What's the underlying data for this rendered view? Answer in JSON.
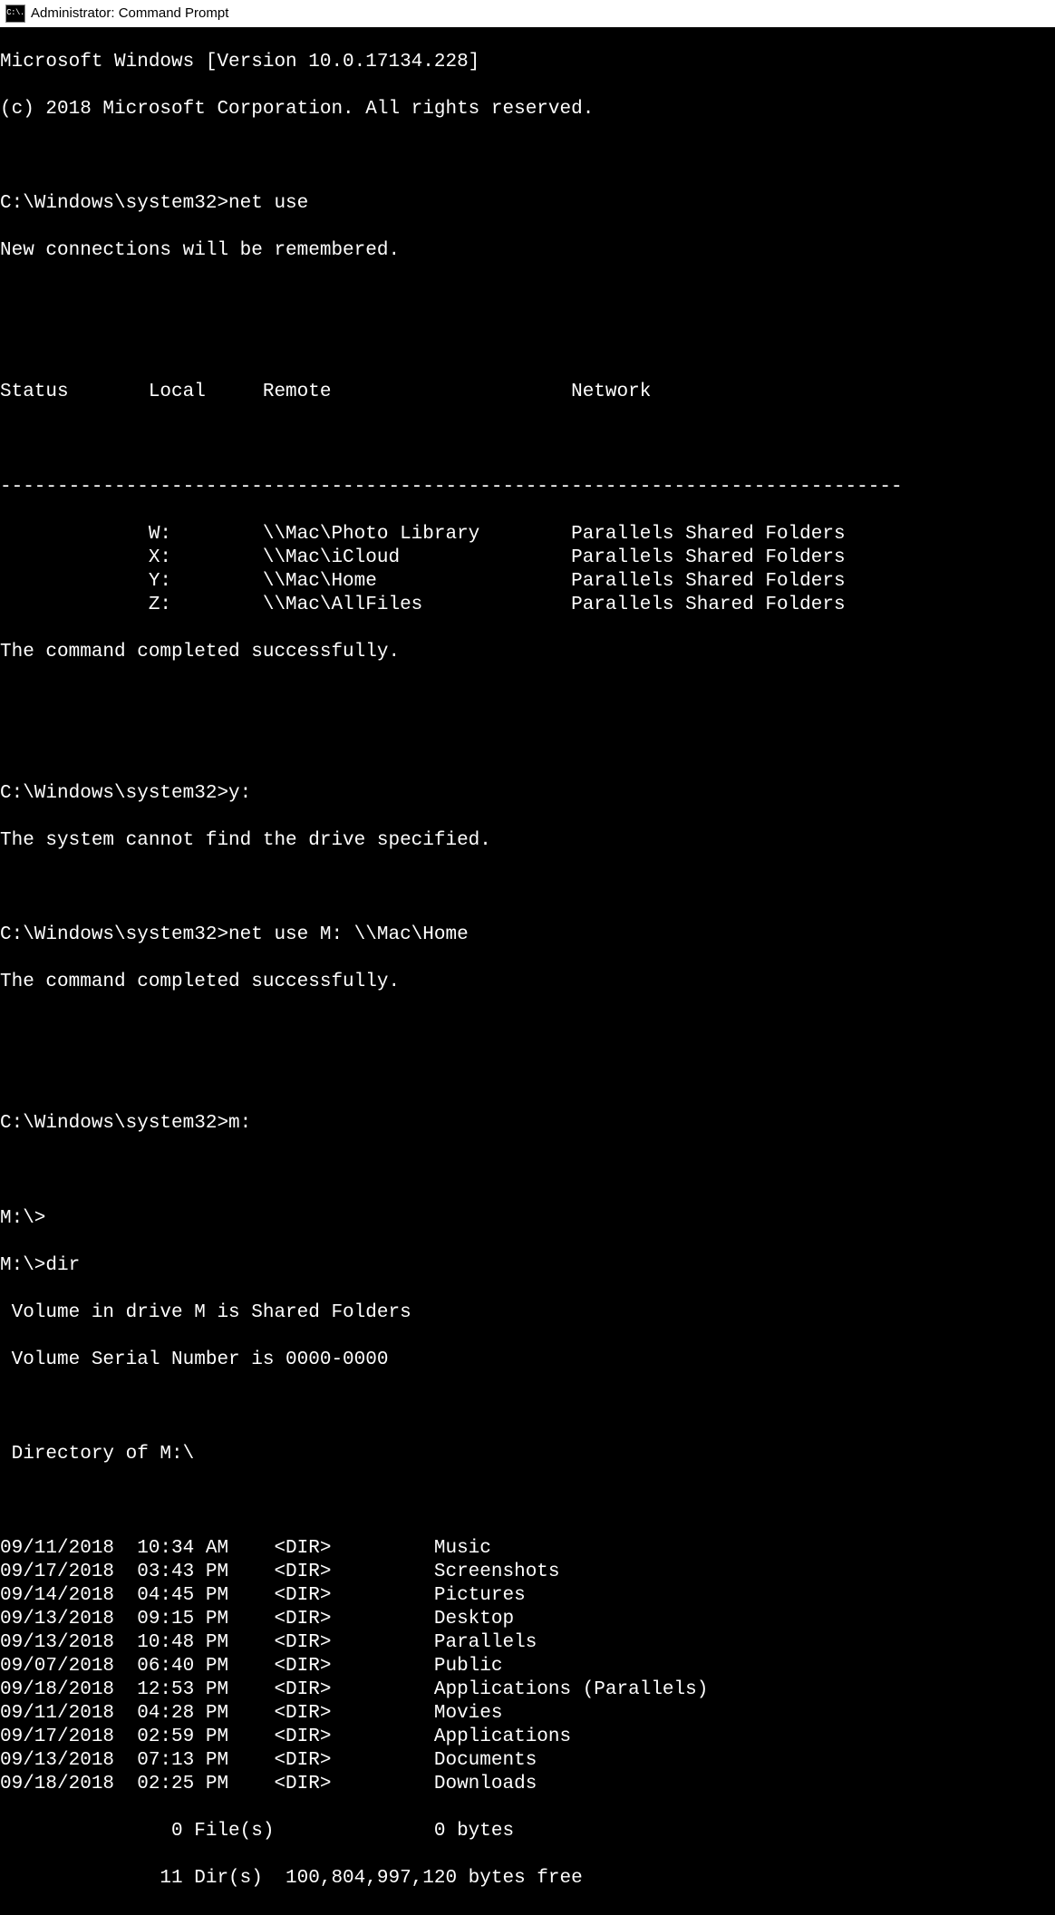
{
  "title_bar": {
    "icon_text": "C:\\.",
    "title": "Administrator: Command Prompt"
  },
  "terminal": {
    "version_line": "Microsoft Windows [Version 10.0.17134.228]",
    "copyright_line": "(c) 2018 Microsoft Corporation. All rights reserved.",
    "prompt1": "C:\\Windows\\system32>",
    "cmd1": "net use",
    "msg_remembered": "New connections will be remembered.",
    "header_status": "Status",
    "header_local": "Local",
    "header_remote": "Remote",
    "header_network": "Network",
    "separator": "-------------------------------------------------------------------------------",
    "net_rows": [
      {
        "status": "",
        "local": "W:",
        "remote": "\\\\Mac\\Photo Library",
        "network": "Parallels Shared Folders"
      },
      {
        "status": "",
        "local": "X:",
        "remote": "\\\\Mac\\iCloud",
        "network": "Parallels Shared Folders"
      },
      {
        "status": "",
        "local": "Y:",
        "remote": "\\\\Mac\\Home",
        "network": "Parallels Shared Folders"
      },
      {
        "status": "",
        "local": "Z:",
        "remote": "\\\\Mac\\AllFiles",
        "network": "Parallels Shared Folders"
      }
    ],
    "msg_success1": "The command completed successfully.",
    "prompt2": "C:\\Windows\\system32>",
    "cmd2": "y:",
    "msg_error_drive": "The system cannot find the drive specified.",
    "prompt3": "C:\\Windows\\system32>",
    "cmd3": "net use M: \\\\Mac\\Home",
    "msg_success2": "The command completed successfully.",
    "prompt4": "C:\\Windows\\system32>",
    "cmd4": "m:",
    "prompt5": "M:\\>",
    "prompt6": "M:\\>",
    "cmd5": "dir",
    "volume_line": " Volume in drive M is Shared Folders",
    "serial_line": " Volume Serial Number is 0000-0000",
    "directory_line": " Directory of M:\\",
    "dir_rows": [
      {
        "date": "09/11/2018",
        "time": "10:34 AM",
        "type": "<DIR>",
        "name": "Music"
      },
      {
        "date": "09/17/2018",
        "time": "03:43 PM",
        "type": "<DIR>",
        "name": "Screenshots"
      },
      {
        "date": "09/14/2018",
        "time": "04:45 PM",
        "type": "<DIR>",
        "name": "Pictures"
      },
      {
        "date": "09/13/2018",
        "time": "09:15 PM",
        "type": "<DIR>",
        "name": "Desktop"
      },
      {
        "date": "09/13/2018",
        "time": "10:48 PM",
        "type": "<DIR>",
        "name": "Parallels"
      },
      {
        "date": "09/07/2018",
        "time": "06:40 PM",
        "type": "<DIR>",
        "name": "Public"
      },
      {
        "date": "09/18/2018",
        "time": "12:53 PM",
        "type": "<DIR>",
        "name": "Applications (Parallels)"
      },
      {
        "date": "09/11/2018",
        "time": "04:28 PM",
        "type": "<DIR>",
        "name": "Movies"
      },
      {
        "date": "09/17/2018",
        "time": "02:59 PM",
        "type": "<DIR>",
        "name": "Applications"
      },
      {
        "date": "09/13/2018",
        "time": "07:13 PM",
        "type": "<DIR>",
        "name": "Documents"
      },
      {
        "date": "09/18/2018",
        "time": "02:25 PM",
        "type": "<DIR>",
        "name": "Downloads"
      }
    ],
    "summary_files": "               0 File(s)              0 bytes",
    "summary_dirs": "              11 Dir(s)  100,804,997,120 bytes free"
  }
}
